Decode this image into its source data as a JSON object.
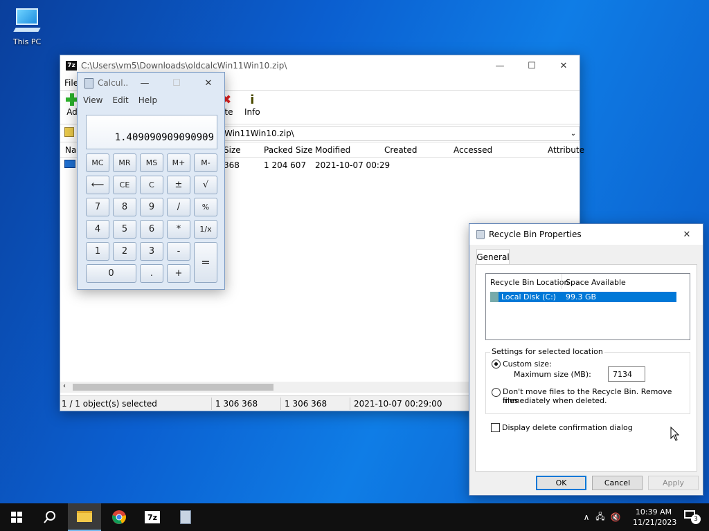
{
  "desktop": {
    "icons": [
      {
        "label": "This PC",
        "icon": "this-pc-icon"
      }
    ]
  },
  "zip": {
    "title": "C:\\Users\\vm5\\Downloads\\oldcalcWin11Win10.zip\\",
    "menu": [
      "File"
    ],
    "toolbar": {
      "add": "Ad",
      "delete": "ete",
      "info": "Info"
    },
    "address": "Win11Win10.zip\\",
    "columns": [
      "Nar",
      "Size",
      "Packed Size",
      "Modified",
      "Created",
      "Accessed",
      "Attribute"
    ],
    "rows": [
      {
        "size": "368",
        "packed": "1 204 607",
        "modified": "2021-10-07 00:29"
      }
    ],
    "status": {
      "selected": "1 / 1 object(s) selected",
      "size": "1 306 368",
      "packed": "1 306 368",
      "date": "2021-10-07 00:29:00"
    }
  },
  "calc": {
    "title": "Calcul...",
    "menu": [
      "View",
      "Edit",
      "Help"
    ],
    "display": "1.409090909090909",
    "keys": {
      "r1": [
        "MC",
        "MR",
        "MS",
        "M+",
        "M-"
      ],
      "r2": [
        "⟵",
        "CE",
        "C",
        "±",
        "√"
      ],
      "r3": [
        "7",
        "8",
        "9",
        "/",
        "%"
      ],
      "r4": [
        "4",
        "5",
        "6",
        "*",
        "1/x"
      ],
      "r5": [
        "1",
        "2",
        "3",
        "-"
      ],
      "r6": [
        "0",
        ".",
        "+"
      ],
      "equals": "="
    }
  },
  "recycle": {
    "title": "Recycle Bin Properties",
    "tab": "General",
    "list_headers": [
      "Recycle Bin Location",
      "Space Available"
    ],
    "selected_location": "Local Disk (C:)",
    "selected_space": "99.3 GB",
    "group_label": "Settings for selected location",
    "custom_size": "Custom size:",
    "max_size_label": "Maximum size (MB):",
    "max_size_value": "7134",
    "dont_move_line1": "Don't move files to the Recycle Bin. Remove files",
    "dont_move_line2": "immediately when deleted.",
    "display_confirm": "Display delete confirmation dialog",
    "ok": "OK",
    "cancel": "Cancel",
    "apply": "Apply"
  },
  "taskbar": {
    "time": "10:39 AM",
    "date": "11/21/2023",
    "notifications": "3",
    "apps": [
      "start-icon",
      "search-icon",
      "file-explorer-icon",
      "chrome-icon",
      "7zip-icon",
      "calculator-icon"
    ]
  },
  "colors": {
    "accent": "#0078d7",
    "taskbar": "#101010",
    "desktop": "#0b5fd0"
  }
}
